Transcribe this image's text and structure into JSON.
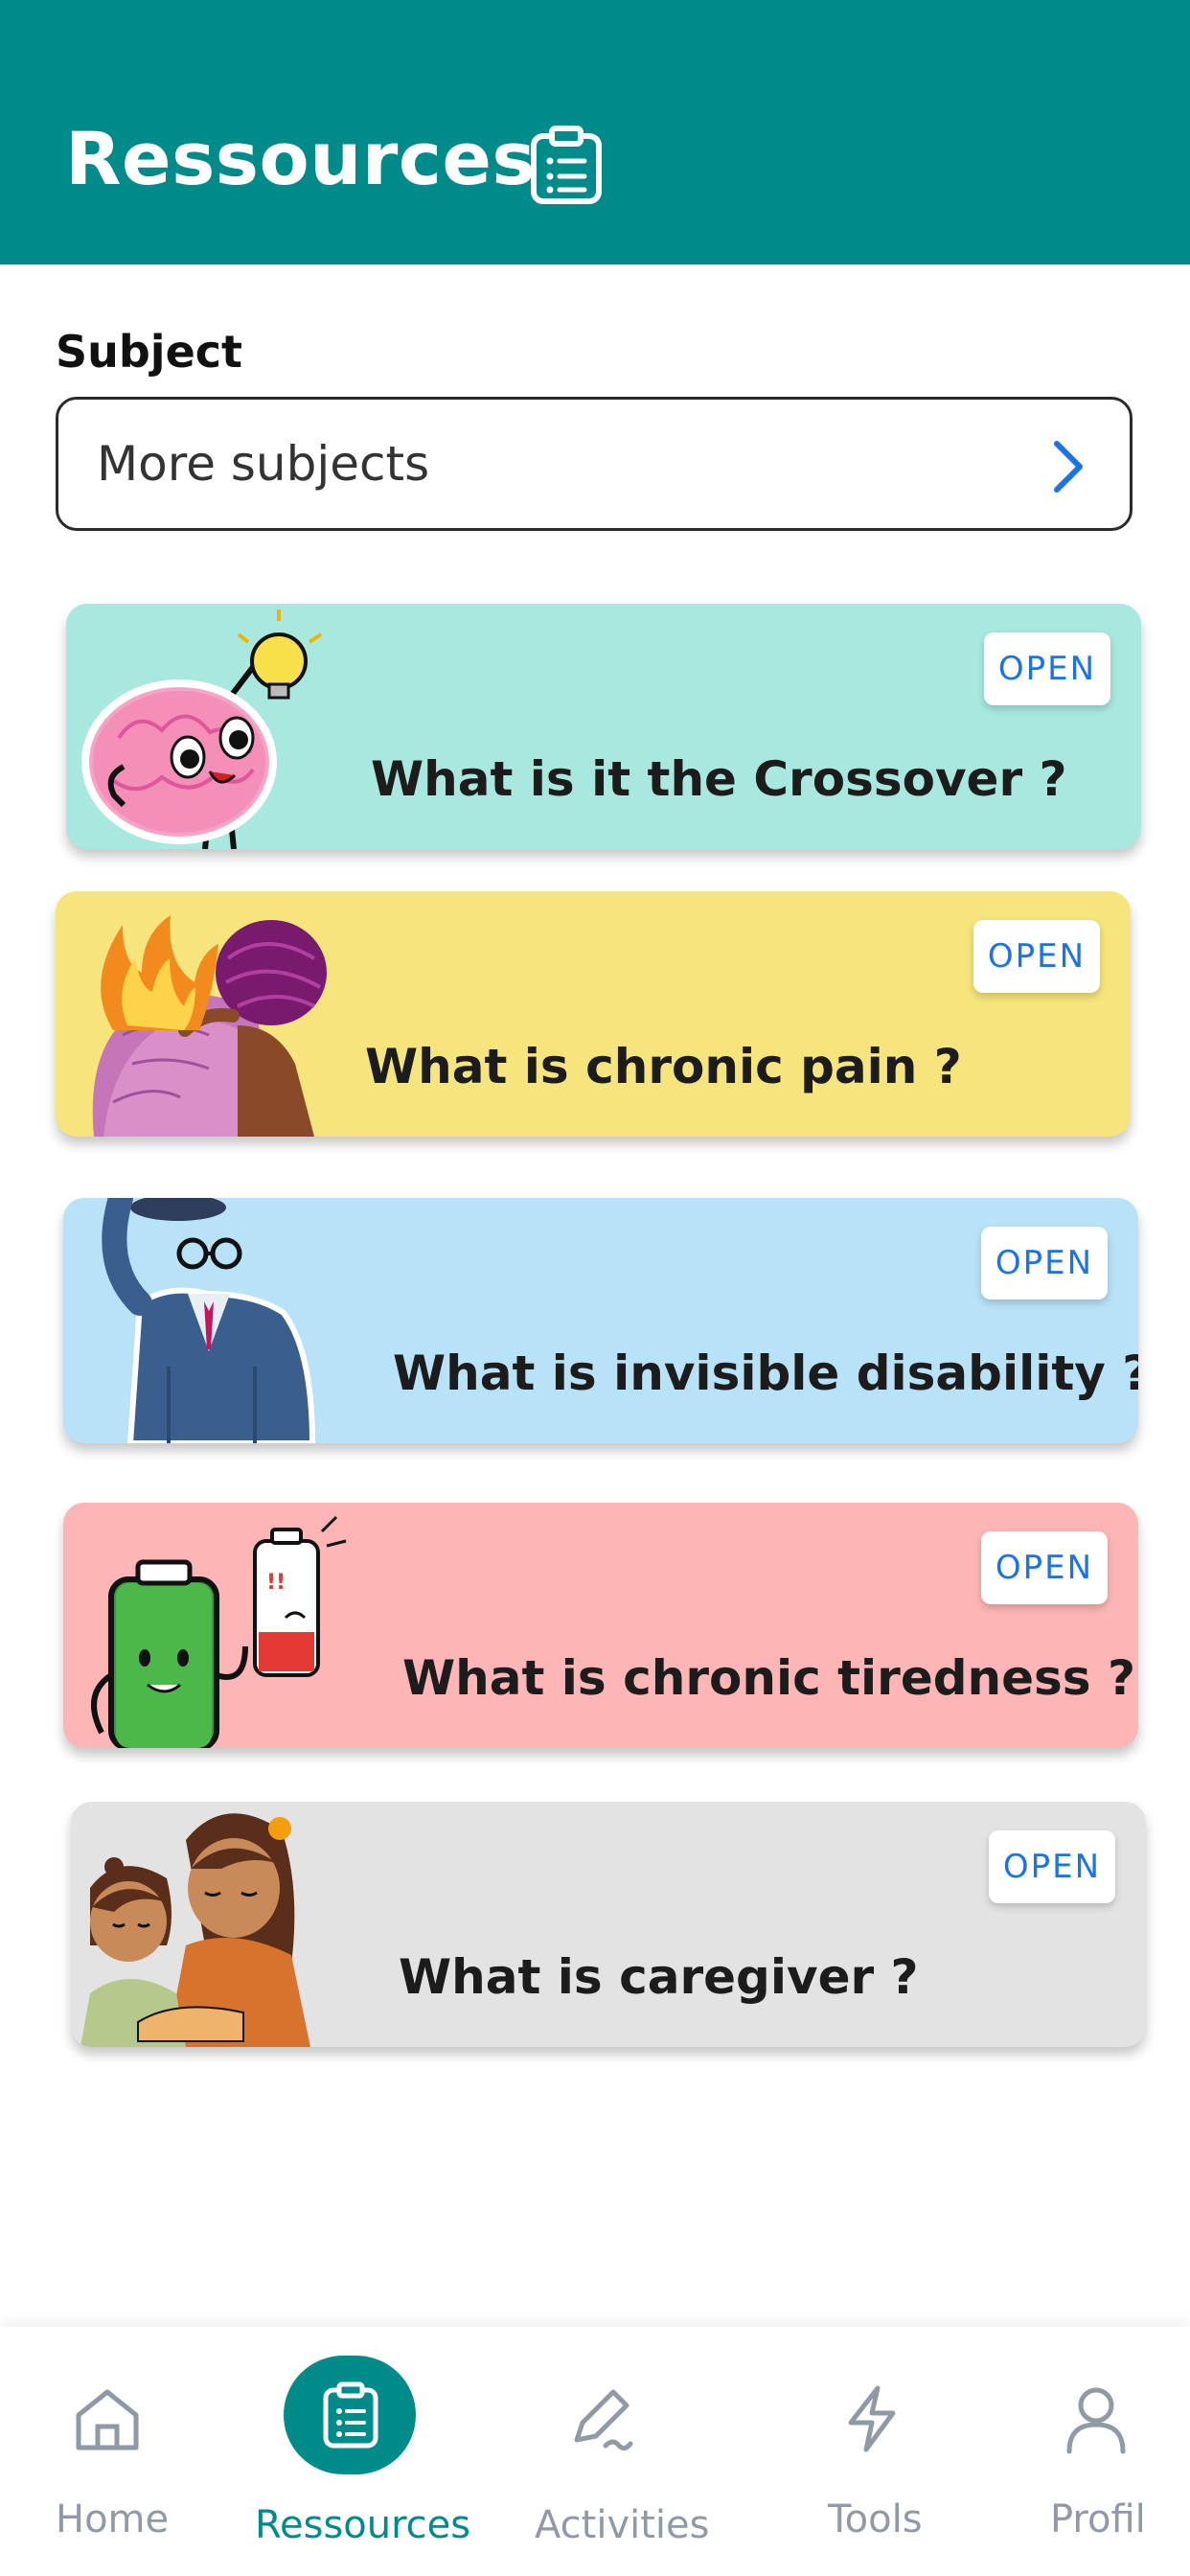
{
  "header": {
    "title": "Ressources",
    "icon": "clipboard-list-icon",
    "bg_color": "#008b8b"
  },
  "subject": {
    "label": "Subject",
    "selected": "More subjects",
    "icon": "chevron-right-icon"
  },
  "cards": [
    {
      "title": "What is it the Crossover ?",
      "button": "OPEN",
      "color": "#a8e8df",
      "illustration": "brain-lightbulb-illustration"
    },
    {
      "title": "What is chronic pain ?",
      "button": "OPEN",
      "color": "#f5e57c",
      "illustration": "burning-back-illustration"
    },
    {
      "title": "What is invisible disability ?",
      "button": "OPEN",
      "color": "#b8e2f8",
      "illustration": "invisible-man-illustration"
    },
    {
      "title": "What is chronic tiredness ?",
      "button": "OPEN",
      "color": "#fdb5b5",
      "illustration": "batteries-illustration"
    },
    {
      "title": "What is caregiver ?",
      "button": "OPEN",
      "color": "#e3e3e3",
      "illustration": "mother-child-illustration"
    }
  ],
  "nav": {
    "items": [
      {
        "label": "Home",
        "icon": "home-icon",
        "active": false
      },
      {
        "label": "Ressources",
        "icon": "clipboard-list-icon",
        "active": true
      },
      {
        "label": "Activities",
        "icon": "pen-icon",
        "active": false
      },
      {
        "label": "Tools",
        "icon": "lightning-icon",
        "active": false
      },
      {
        "label": "Profil",
        "icon": "user-icon",
        "active": false
      }
    ],
    "active_color": "#008b8b",
    "inactive_color": "#8f9aa6"
  }
}
